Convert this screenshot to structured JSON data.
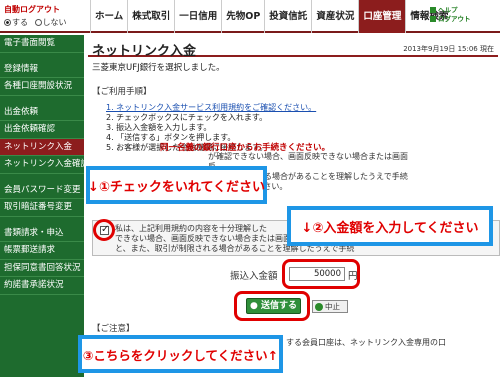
{
  "topbar": {
    "autologout_label": "自動ログアウト",
    "radio_on": "する",
    "radio_off": "しない",
    "nav": [
      "ホーム",
      "株式取引",
      "一日信用",
      "先物OP",
      "投資信託",
      "資産状況",
      "口座管理",
      "情報検索"
    ],
    "active_nav": "口座管理",
    "help_label": "ヘルプ",
    "logout_label": "ログアウト"
  },
  "sidebar": {
    "items": [
      "電子書面閲覧",
      "登録情報",
      "各種口座開設状況",
      "出金依頼",
      "出金依頼確認",
      "ネットリンク入金",
      "ネットリンク入金確認",
      "会員パスワード変更",
      "取引暗証番号変更",
      "書類請求・申込",
      "帳票郵送請求",
      "担保同意書回答状況",
      "約諾書承諾状況"
    ],
    "active": "ネットリンク入金"
  },
  "main": {
    "title": "ネットリンク入金",
    "timestamp": "2013年9月19日 15:06 現在",
    "subtitle": "三菱東京UFJ銀行を選択しました。",
    "usage_label": "【ご利用手順】",
    "steps": [
      "1. ネットリンク入金サービス利用規約をご確認ください。",
      "2. チェックボックスにチェックを入れます。",
      "3. 振込入金額を入力します。",
      "4. 「送信する」ボタンを押します。",
      "5. お客様が選択した金融機関に接続します。"
    ],
    "warning_red": "同一名義の銀行口座からお手続きください。",
    "warning_body": "が確認できない場合、画面反映できない場合または画面反\n取引が制限される場合があることを理解したうえで手続\nきを行ってください。",
    "agree_text": "私は、上記利用規約の内容を十分理解した\nできない場合、画面反映できない場合または画面反\nと、また、取引が制限される場合があることを理解したうえで手続",
    "amount_label": "振込入金額",
    "amount_value": "50000",
    "amount_unit": "円",
    "submit_label": "送信する",
    "cancel_label": "中止",
    "notes_label": "【ご注意】",
    "notes_tail": "する会員口座は、ネットリンク入金専用の口"
  },
  "callouts": {
    "check": "↓①チェックをいれてください",
    "amount": "↓②入金額を入力してください",
    "click": "③こちらをクリックしてください↑"
  },
  "colors": {
    "accent": "#8c1d1d",
    "sidebar": "#1e6b2e",
    "callout_border": "#1e96e6",
    "callout_text": "#e00000"
  }
}
